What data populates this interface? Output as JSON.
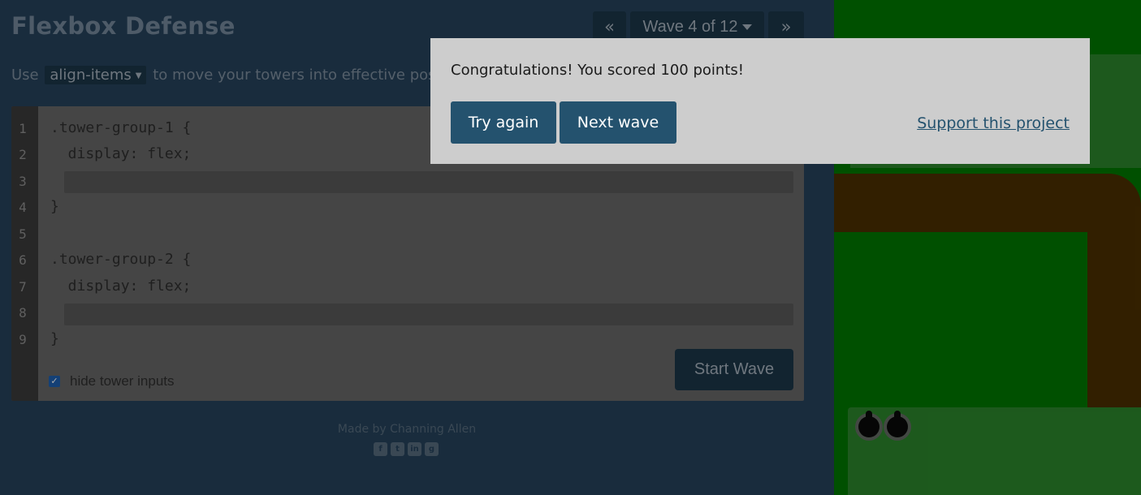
{
  "app": {
    "title": "Flexbox Defense"
  },
  "nav": {
    "prev_icon": "«",
    "wave_label": "Wave 4 of 12",
    "next_icon": "»"
  },
  "instructions": {
    "before": "Use",
    "property": "align-items",
    "after": "to move your towers into effective positio"
  },
  "editor": {
    "line_numbers": [
      "1",
      "2",
      "3",
      "4",
      "5",
      "6",
      "7",
      "8",
      "9"
    ],
    "lines": [
      ".tower-group-1 {",
      "  display: flex;",
      "",
      "}",
      "",
      ".tower-group-2 {",
      "  display: flex;",
      "",
      "}"
    ],
    "hide_inputs_label": "hide tower inputs",
    "hide_inputs_checked": true,
    "start_button": "Start Wave"
  },
  "footer": {
    "credit": "Made by Channing Allen",
    "social_icons": [
      "facebook-icon",
      "twitter-icon",
      "linkedin-icon",
      "github-icon"
    ]
  },
  "modal": {
    "message": "Congratulations! You scored 100 points!",
    "try_again": "Try again",
    "next_wave": "Next wave",
    "support_link": "Support this project"
  },
  "colors": {
    "background": "#25415a",
    "grass": "#007700",
    "path": "#4b2f00",
    "button": "#24526e"
  }
}
